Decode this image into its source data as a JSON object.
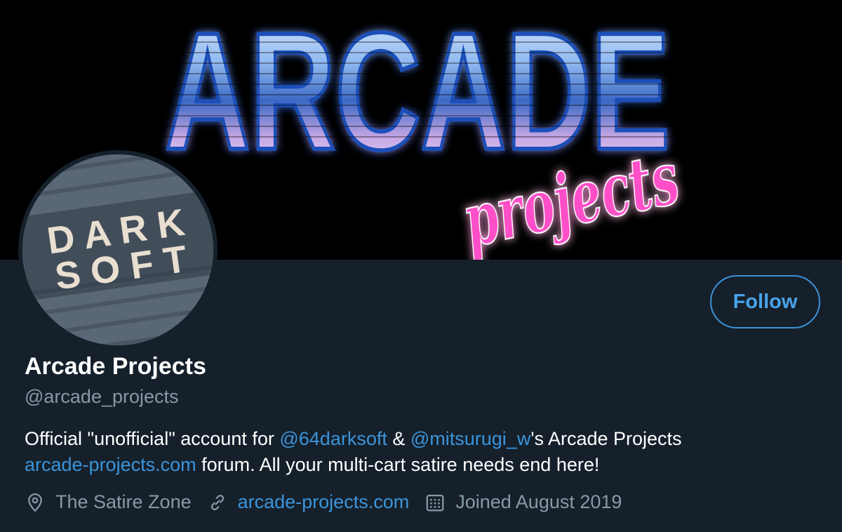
{
  "banner": {
    "logo_word": "ARCADE",
    "logo_script": "projects"
  },
  "avatar": {
    "line1": "D A R K",
    "line2": "S O F T"
  },
  "profile": {
    "display_name": "Arcade Projects",
    "handle": "@arcade_projects",
    "follow_label": "Follow"
  },
  "bio": {
    "part1": "Official \"unofficial\" account for ",
    "mention1": "@64darksoft",
    "part2": " & ",
    "mention2": "@mitsurugi_w",
    "part3": "'s Arcade Projects",
    "link": "arcade-projects.com",
    "part4": " forum. All your multi-cart satire needs end here!"
  },
  "meta": {
    "location": "The Satire Zone",
    "website": "arcade-projects.com",
    "joined": "Joined August 2019"
  },
  "colors": {
    "background": "#15202b",
    "accent": "#3b94d9",
    "secondary_text": "#8899a6",
    "logo_blue": "#8fb8f0",
    "logo_pink": "#ff4fc8"
  }
}
